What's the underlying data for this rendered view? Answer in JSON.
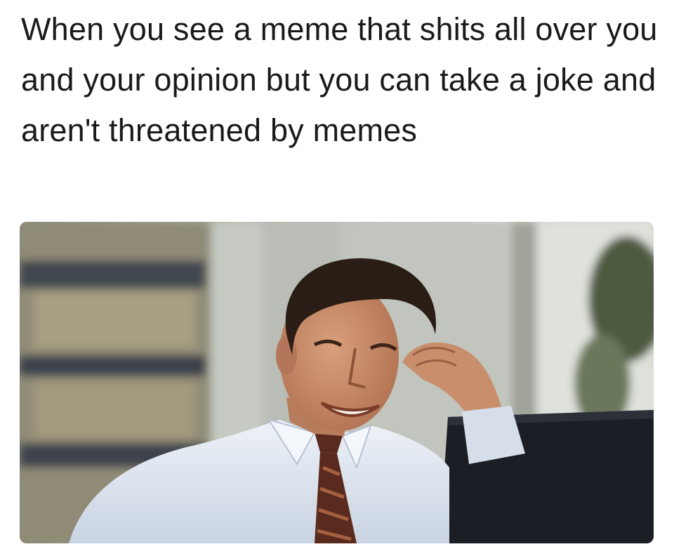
{
  "meme": {
    "caption": "When you see a meme that shits all over you and your opinion but you can take a joke and aren't threatened by memes"
  },
  "photo": {
    "subject": "smiling businessman in an office leaning on his hand in front of a monitor",
    "colors": {
      "background": "#b8bcb3",
      "shirt": "#dfe6f0",
      "hair": "#2a1d15",
      "skin": "#c98f6c",
      "tie": "#5a2a1e",
      "monitor": "#1b1e24"
    }
  }
}
